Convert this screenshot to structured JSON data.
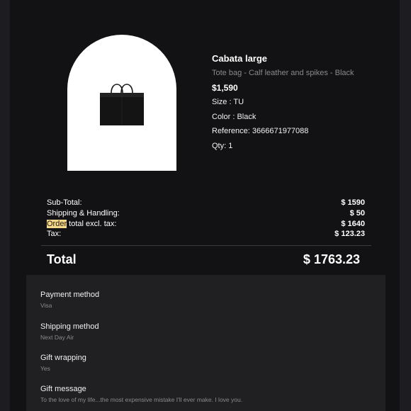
{
  "product": {
    "name": "Cabata large",
    "description": "Tote bag - Calf leather and spikes - Black",
    "price": "$1,590",
    "size": "Size : TU",
    "color": "Color : Black",
    "reference": "Reference: 3666671977088",
    "qty": "Qty: 1",
    "image_icon": "tote-bag-icon"
  },
  "summary": {
    "subtotal_label": "Sub-Total:",
    "subtotal_value": "$ 1590",
    "shipping_label": "Shipping & Handling:",
    "shipping_value": "$ 50",
    "order_total_highlight": "Order",
    "order_total_label_rest": " total excl. tax:",
    "order_total_value": "$ 1640",
    "tax_label": "Tax:",
    "tax_value": "$ 123.23"
  },
  "total": {
    "label": "Total",
    "value": "$ 1763.23"
  },
  "details": {
    "payment_label": "Payment method",
    "payment_value": "Visa",
    "shipping_label": "Shipping method",
    "shipping_value": "Next Day Air",
    "gift_wrap_label": "Gift wrapping",
    "gift_wrap_value": "Yes",
    "gift_message_label": "Gift message",
    "gift_message_value": "To the love of my life...the most expensive mistake I'll ever make. I love you."
  },
  "colors": {
    "page_bg": "#1d1d21",
    "panel_bg": "#121214",
    "details_bg": "#202022",
    "highlight": "#f3d78a",
    "muted_text": "#8a8a8e"
  }
}
